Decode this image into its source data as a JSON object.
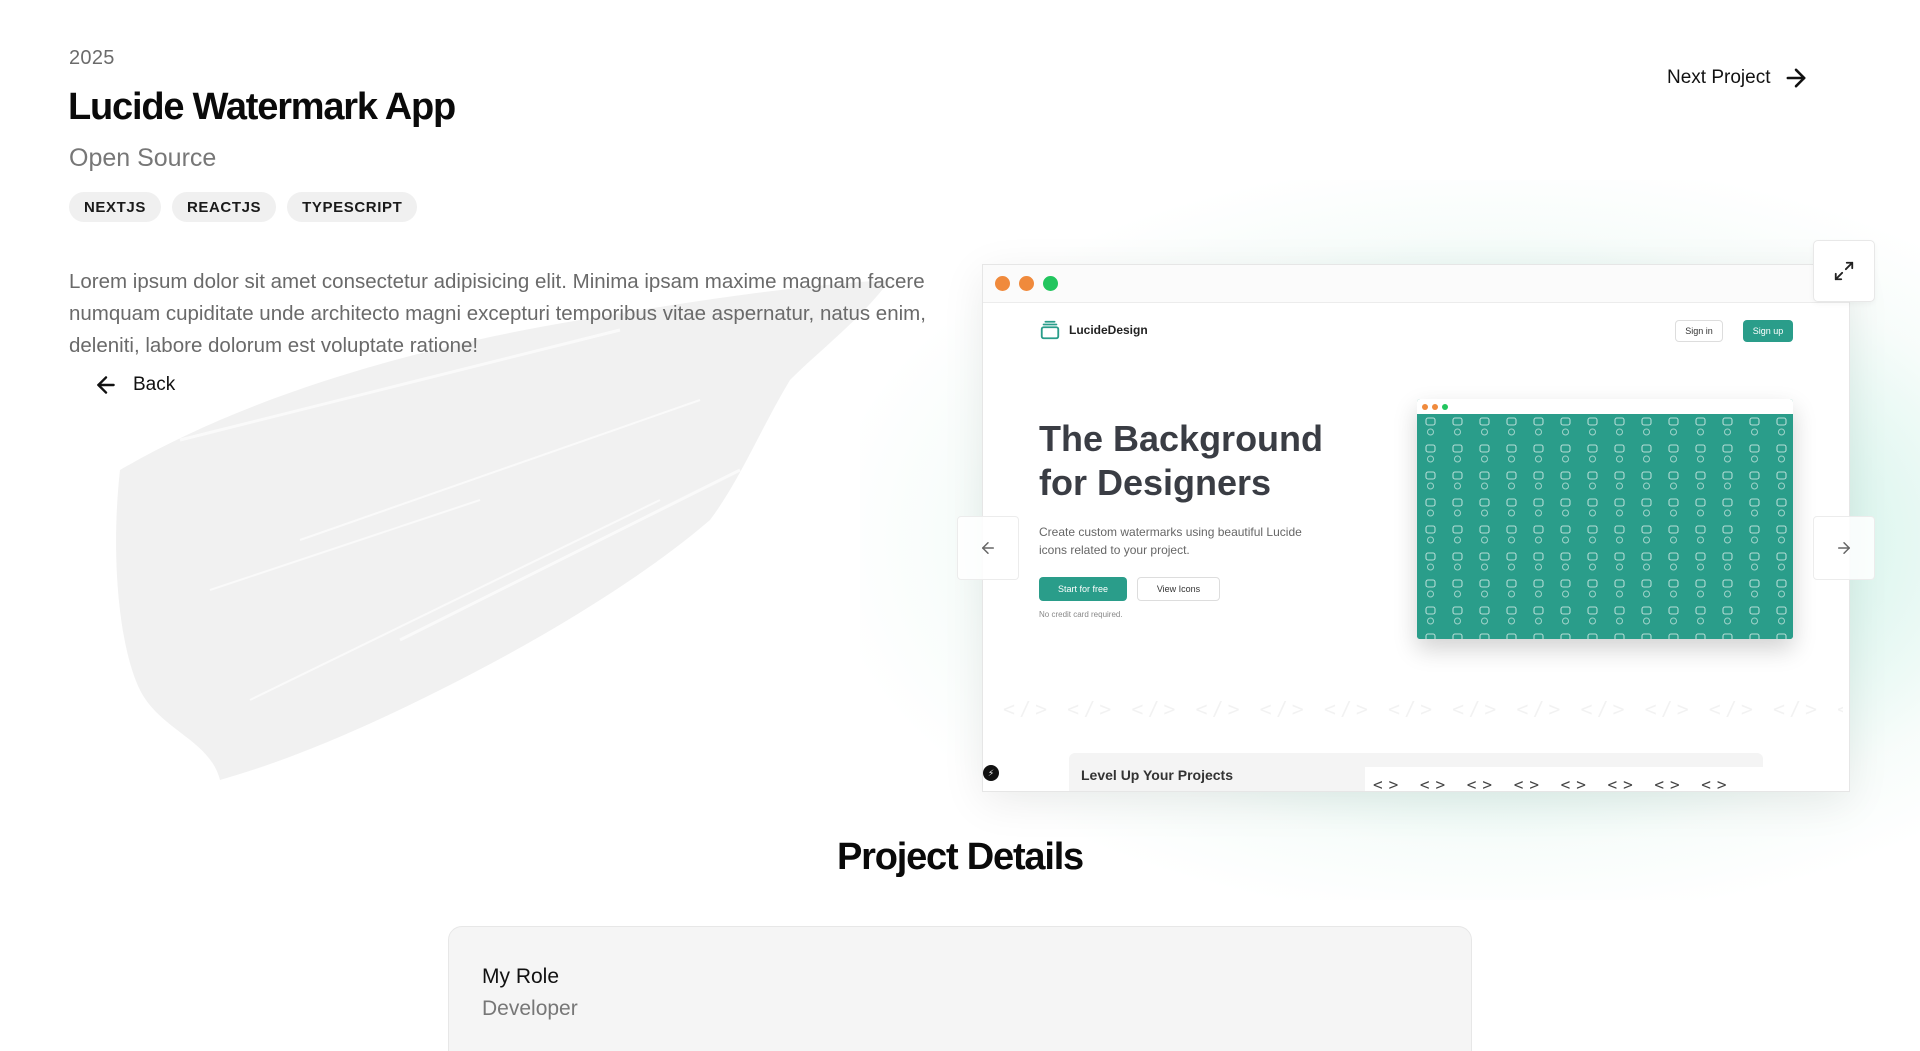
{
  "project": {
    "year": "2025",
    "title": "Lucide Watermark App",
    "subtitle": "Open Source",
    "tags": [
      "NEXTJS",
      "REACTJS",
      "TYPESCRIPT"
    ],
    "description": "Lorem ipsum dolor sit amet consectetur adipisicing elit. Minima ipsam maxime magnam facere numquam cupiditate unde architecto magni excepturi temporibus vitae aspernatur, natus enim, deleniti, labore dolorum est voluptate ratione!"
  },
  "nav": {
    "back_label": "Back",
    "next_label": "Next Project"
  },
  "preview": {
    "window_dot_colors": [
      "#f08a3c",
      "#f08a3c",
      "#22c55e"
    ],
    "brand_name": "LucideDesign",
    "sign_in_label": "Sign in",
    "sign_up_label": "Sign up",
    "hero_title": "The Background for Designers",
    "hero_subtitle": "Create custom watermarks using beautiful Lucide icons related to your project.",
    "start_label": "Start for free",
    "view_icons_label": "View Icons",
    "note": "No credit card required.",
    "section_title": "Level Up Your Projects",
    "accent_color": "#2a9d8a"
  },
  "details": {
    "heading": "Project Details",
    "role_label": "My Role",
    "role_value": "Developer"
  },
  "icons": {
    "back": "arrow-left-icon",
    "next": "arrow-right-icon",
    "expand": "expand-icon",
    "carousel_prev": "arrow-left-icon",
    "carousel_next": "arrow-right-icon"
  }
}
